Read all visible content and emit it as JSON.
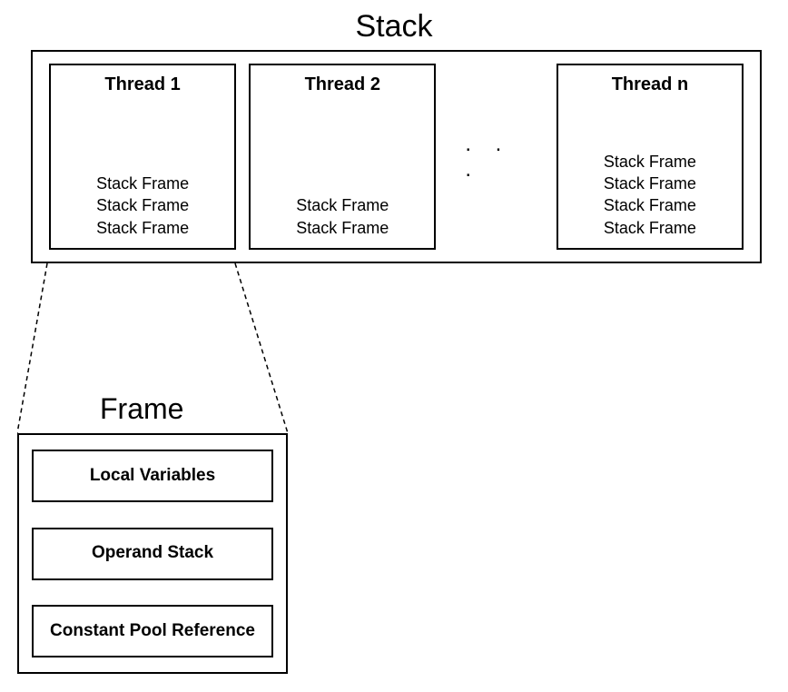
{
  "stack": {
    "title": "Stack",
    "threads": [
      {
        "title": "Thread 1",
        "frames": [
          "Stack Frame",
          "Stack Frame",
          "Stack Frame"
        ]
      },
      {
        "title": "Thread 2",
        "frames": [
          "Stack Frame",
          "Stack Frame"
        ]
      },
      {
        "title": "Thread n",
        "frames": [
          "Stack Frame",
          "Stack Frame",
          "Stack Frame",
          "Stack Frame"
        ]
      }
    ],
    "ellipsis": ". . ."
  },
  "frame": {
    "title": "Frame",
    "sections": [
      "Local Variables",
      "Operand Stack",
      "Constant Pool Reference"
    ]
  }
}
